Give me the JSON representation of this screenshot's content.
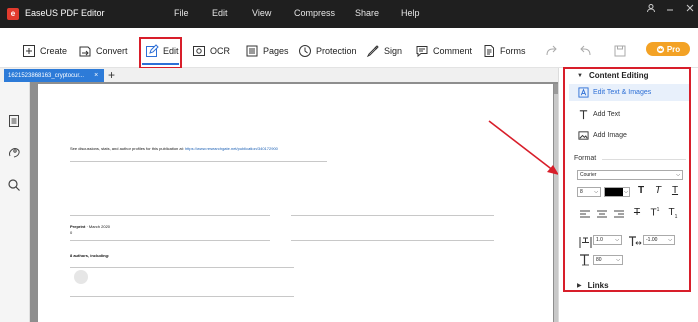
{
  "titlebar": {
    "app_title": "EaseUS PDF Editor",
    "menu": [
      "File",
      "Edit",
      "View",
      "Compress",
      "Share",
      "Help"
    ]
  },
  "toolbar": {
    "create": "Create",
    "convert": "Convert",
    "edit": "Edit",
    "ocr": "OCR",
    "pages": "Pages",
    "protection": "Protection",
    "sign": "Sign",
    "comment": "Comment",
    "forms": "Forms",
    "pro": "Pro"
  },
  "tabs": {
    "doc_tab": "1621523868163_cryptocur...",
    "close": "×",
    "add": "+"
  },
  "document": {
    "see_prefix": "See discussions, stats, and author profiles for this publication at: ",
    "see_link": "https://www.researchgate.net/publication/340172900",
    "preprint_bold": "Preprint",
    "preprint_rest": " · March 2020",
    "zero": "0",
    "authors": "8 authors, including:"
  },
  "panel": {
    "content_editing": "Content Editing",
    "edit_text_images": "Edit Text & Images",
    "add_text": "Add Text",
    "add_image": "Add Image",
    "format": "Format",
    "font": "Courier",
    "font_size": "8",
    "char_spacing": "1.0",
    "line_spacing": "-1.00",
    "scale": "80",
    "links": "Links"
  },
  "colors": {
    "highlight_red": "#d81e2a",
    "accent_blue": "#2d6fd6",
    "pro_orange": "#f3a225",
    "titlebar": "#1f1f1f"
  }
}
